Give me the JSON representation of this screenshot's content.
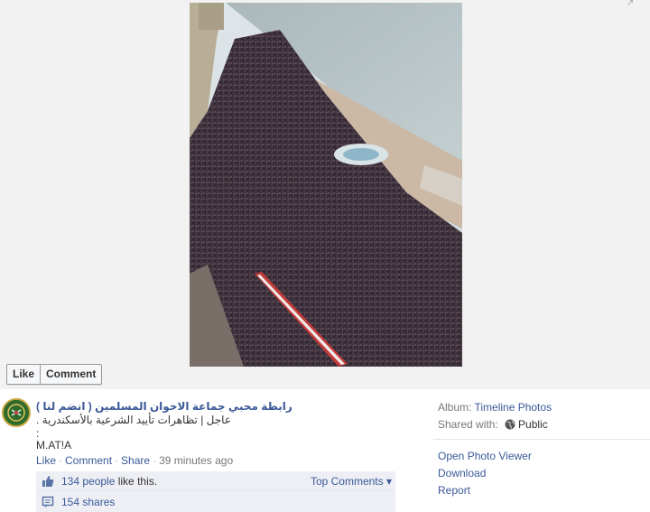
{
  "stage": {
    "like_label": "Like",
    "comment_label": "Comment",
    "popout_glyph": "↗"
  },
  "post": {
    "author": "رابطة محبي جماعة الاخوان المسلمين ( انضم لنا )",
    "caption_line1": "عاجل | تظاهرات تأييد الشرعية بالأسكندرية .",
    "caption_line2": ":",
    "caption_line3": "M.AT!A",
    "meta": {
      "like": "Like",
      "comment": "Comment",
      "share": "Share",
      "time": "39 minutes ago"
    },
    "likes": {
      "count_link": "134 people",
      "suffix": " like this.",
      "top_comments": "Top Comments ▾"
    },
    "shares": "154 shares"
  },
  "side": {
    "album_label": "Album: ",
    "album_value": "Timeline Photos",
    "shared_label": "Shared with: ",
    "shared_value": "Public",
    "actions": [
      "Open Photo Viewer",
      "Download",
      "Report"
    ]
  },
  "colors": {
    "link": "#3b5998",
    "stage_bg": "#f2f2f2",
    "likes_box_bg": "#edeff4"
  },
  "icons": [
    "popout-icon",
    "avatar-emblem",
    "thumbs-up-icon",
    "shares-icon",
    "globe-icon"
  ]
}
